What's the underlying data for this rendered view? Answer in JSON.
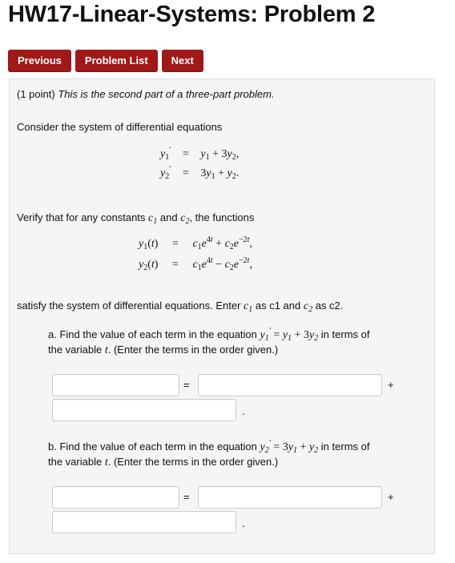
{
  "page": {
    "title": "HW17-Linear-Systems: Problem 2"
  },
  "nav": {
    "previous": "Previous",
    "problem_list": "Problem List",
    "next": "Next"
  },
  "problem": {
    "points": "(1 point)",
    "intro": "This is the second part of a three-part problem.",
    "consider": "Consider the system of differential equations",
    "verify_prefix": "Verify that for any constants",
    "verify_and": "and",
    "verify_suffix": ", the functions",
    "satisfy": "satisfy the system of differential equations. Enter",
    "satisfy_as1": "as c1 and",
    "satisfy_as2": "as c2.",
    "part_a": {
      "line1_prefix": "a. Find the value of each term in the equation",
      "line1_suffix": "in terms of",
      "line2": "the variable",
      "line2_suffix": ". (Enter the terms in the order given.)",
      "equals": "=",
      "plus": "+",
      "period": "."
    },
    "part_b": {
      "line1_prefix": "b. Find the value of each term in the equation",
      "line1_suffix": "in terms of",
      "line2": "the variable",
      "line2_suffix": ". (Enter the terms in the order given.)",
      "equals": "=",
      "plus": "+",
      "period": "."
    }
  }
}
